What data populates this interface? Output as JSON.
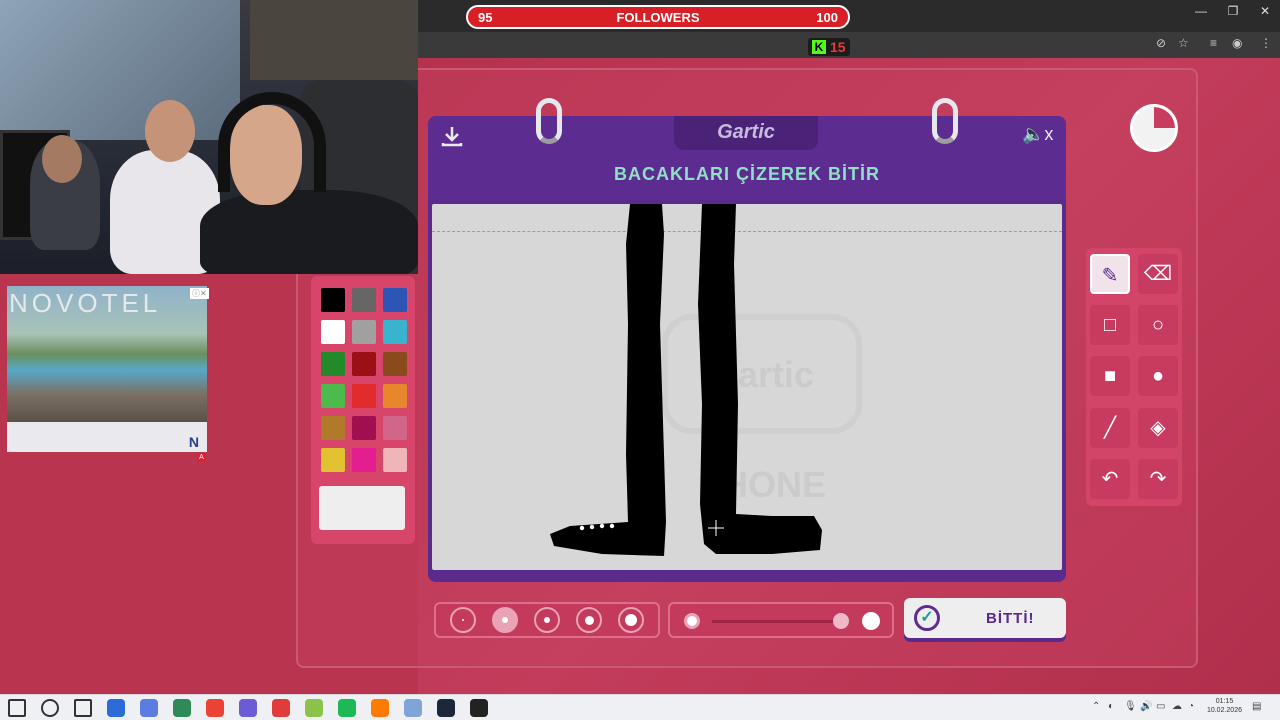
{
  "stream_overlay": {
    "followers": {
      "label": "FOLLOWERS",
      "current": "95",
      "goal": "100"
    },
    "kick": {
      "logo": "K",
      "viewer_count": "15"
    }
  },
  "ad": {
    "brand": "NOVOTEL",
    "mark": "N",
    "badge": "A"
  },
  "game": {
    "logo": "Gartic",
    "instruction": "BACAKLARI ÇİZEREK BİTİR",
    "mute_suffix": "x",
    "watermark": "Gartic PHONE",
    "done_label": "BİTTİ!",
    "palette": [
      "#000000",
      "#666666",
      "#2c55b5",
      "#ffffff",
      "#a0a0a0",
      "#3ab3cf",
      "#238a2a",
      "#9a1016",
      "#8a4a1c",
      "#4cbb4c",
      "#e22b2b",
      "#e8862b",
      "#b07a2a",
      "#a01050",
      "#d1668a",
      "#e3c232",
      "#e31e8e",
      "#f0b5b9"
    ],
    "current_color": "#eeeeee",
    "brush_sizes": [
      {
        "dot": 2,
        "active": false
      },
      {
        "dot": 6,
        "active": true
      },
      {
        "dot": 6,
        "active": false
      },
      {
        "dot": 9,
        "active": false
      },
      {
        "dot": 12,
        "active": false
      }
    ],
    "opacity_level": 0.95,
    "timer_remaining_fraction": 0.75,
    "tools": [
      {
        "name": "pencil-tool",
        "glyph": "✎",
        "active": true
      },
      {
        "name": "eraser-tool",
        "glyph": "⌫",
        "active": false
      },
      {
        "name": "rectangle-outline-tool",
        "glyph": "□",
        "active": false
      },
      {
        "name": "ellipse-outline-tool",
        "glyph": "○",
        "active": false
      },
      {
        "name": "rectangle-fill-tool",
        "glyph": "■",
        "active": false
      },
      {
        "name": "ellipse-fill-tool",
        "glyph": "●",
        "active": false
      },
      {
        "name": "line-tool",
        "glyph": "╱",
        "active": false
      },
      {
        "name": "fill-bucket-tool",
        "glyph": "◈",
        "active": false
      },
      {
        "name": "undo-tool",
        "glyph": "↶",
        "active": false
      },
      {
        "name": "redo-tool",
        "glyph": "↷",
        "active": false
      }
    ]
  },
  "taskbar": {
    "time": "01:15",
    "date": "10.02.2026",
    "apps": [
      "start",
      "search",
      "task-view",
      "app1",
      "app2",
      "app3",
      "chrome",
      "app5",
      "app6",
      "app7",
      "spotify",
      "app9",
      "app10",
      "steam",
      "app12"
    ]
  }
}
